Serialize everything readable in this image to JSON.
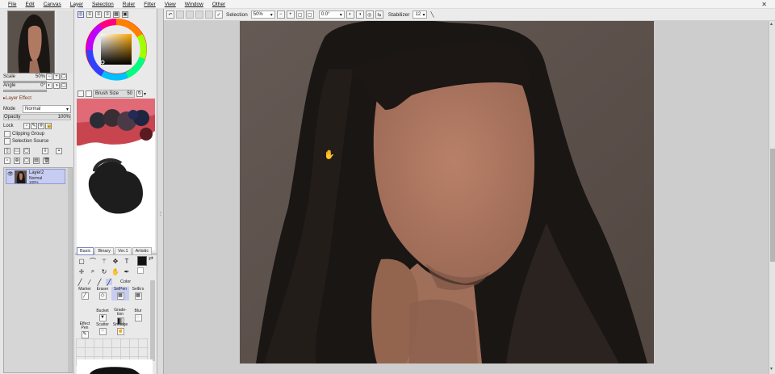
{
  "menubar": {
    "items": [
      "File",
      "Edit",
      "Canvas",
      "Layer",
      "Selection",
      "Ruler",
      "Filter",
      "View",
      "Window",
      "Other"
    ],
    "close_glyph": "✕"
  },
  "toolbar": {
    "selection_label": "Selection",
    "zoom_value": "50%",
    "rotation_value": "0.0°",
    "stabilizer_label": "Stabilizer",
    "stabilizer_value": "12"
  },
  "navigator": {
    "scale_label": "Scale",
    "scale_value": "50%",
    "angle_label": "Angle",
    "angle_value": "0°"
  },
  "layer_effect": {
    "header": "Layer Effect",
    "mode_label": "Mode",
    "mode_value": "Normal",
    "opacity_label": "Opacity",
    "opacity_value": "100%",
    "lock_label": "Lock",
    "clipping_label": "Clipping Group",
    "selection_source_label": "Selection Source"
  },
  "layers": [
    {
      "name": "Layer2",
      "mode": "Normal",
      "opacity": "100%"
    }
  ],
  "brush": {
    "size_label": "Brush Size",
    "size_value": "50"
  },
  "tool_tabs": [
    "Basic",
    "Binary",
    "Ver.1",
    "Artistic"
  ],
  "color_label": "Color",
  "brush_tools": [
    {
      "label": "Marker"
    },
    {
      "label": "Eraser"
    },
    {
      "label": "SelPen"
    },
    {
      "label": "SelErs"
    },
    {
      "label": "Bucket"
    },
    {
      "label": "Grade-\ntion"
    },
    {
      "label": "Blur"
    },
    {
      "label": "Effect\nPen"
    },
    {
      "label": "Scatter"
    },
    {
      "label": "Smudge"
    }
  ],
  "colors": {
    "accent": "#8f99d6",
    "canvas_bg": "#5e524d",
    "hair": "#1a1614",
    "skin": "#b07a62"
  }
}
